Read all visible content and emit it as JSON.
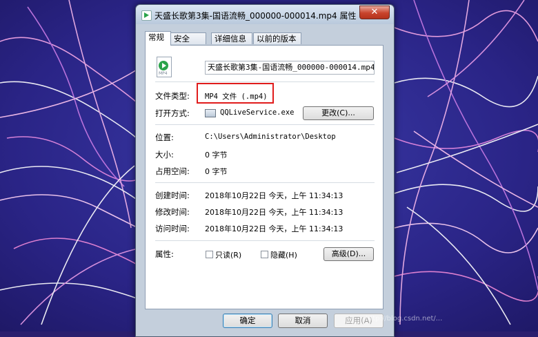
{
  "window": {
    "title": "天盛长歌第3集-国语流畅_000000-000014.mp4 属性",
    "close_symbol": "✕"
  },
  "tabs": [
    {
      "label": "常规",
      "active": true
    },
    {
      "label": "安全",
      "active": false
    },
    {
      "label": "详细信息",
      "active": false
    },
    {
      "label": "以前的版本",
      "active": false
    }
  ],
  "general": {
    "icon_ext": "MP4",
    "file_name": "天盛长歌第3集-国语流畅_000000-000014.mp4",
    "type_label": "文件类型:",
    "type_value": "MP4 文件 (.mp4)",
    "open_with_label": "打开方式:",
    "open_with_value": "QQLiveService.exe",
    "change_button": "更改(C)...",
    "location_label": "位置:",
    "location_value": "C:\\Users\\Administrator\\Desktop",
    "size_label": "大小:",
    "size_value": "0 字节",
    "size_on_disk_label": "占用空间:",
    "size_on_disk_value": "0 字节",
    "created_label": "创建时间:",
    "created_value": "2018年10月22日 今天，上午 11:34:13",
    "modified_label": "修改时间:",
    "modified_value": "2018年10月22日 今天，上午 11:34:13",
    "accessed_label": "访问时间:",
    "accessed_value": "2018年10月22日 今天，上午 11:34:13",
    "attributes_label": "属性:",
    "readonly_label": "只读(R)",
    "readonly_checked": false,
    "hidden_label": "隐藏(H)",
    "hidden_checked": false,
    "advanced_button": "高级(D)..."
  },
  "buttons": {
    "ok": "确定",
    "cancel": "取消",
    "apply": "应用(A)"
  },
  "watermark": "http://blog.csdn.net/...",
  "colors": {
    "highlight_box": "#e01b1b",
    "close_button": "#c8432c"
  }
}
